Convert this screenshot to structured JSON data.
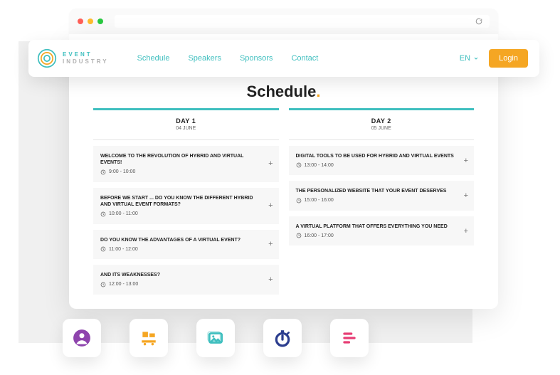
{
  "browser": {
    "title": ""
  },
  "brand": {
    "line1": "EVENT",
    "line2": "INDUSTRY"
  },
  "nav": {
    "items": [
      "Schedule",
      "Speakers",
      "Sponsors",
      "Contact"
    ],
    "lang": "EN",
    "login": "Login"
  },
  "page": {
    "title": "Schedule",
    "title_dot": "."
  },
  "days": [
    {
      "name": "DAY 1",
      "date": "04 JUNE",
      "sessions": [
        {
          "title": "WELCOME TO THE REVOLUTION OF HYBRID AND VIRTUAL EVENTS!",
          "time": "9:00 - 10:00"
        },
        {
          "title": "BEFORE WE START ... DO YOU KNOW THE DIFFERENT HYBRID AND VIRTUAL EVENT FORMATS?",
          "time": "10:00 - 11:00"
        },
        {
          "title": "DO YOU KNOW THE ADVANTAGES OF A VIRTUAL EVENT?",
          "time": "11:00 - 12:00"
        },
        {
          "title": "AND ITS WEAKNESSES?",
          "time": "12:00 - 13:00"
        }
      ]
    },
    {
      "name": "DAY 2",
      "date": "05 JUNE",
      "sessions": [
        {
          "title": "DIGITAL TOOLS TO BE USED FOR HYBRID AND VIRTUAL EVENTS",
          "time": "13:00 - 14:00"
        },
        {
          "title": "THE PERSONALIZED WEBSITE THAT YOUR EVENT DESERVES",
          "time": "15:00 - 16:00"
        },
        {
          "title": "A VIRTUAL PLATFORM THAT OFFERS EVERYTHING YOU NEED",
          "time": "16:00 - 17:00"
        }
      ]
    }
  ],
  "tools": {
    "items": [
      {
        "name": "profile-icon",
        "color": "#8e44ad"
      },
      {
        "name": "blocks-icon",
        "color": "#f5a623"
      },
      {
        "name": "image-icon",
        "color": "#3fbfbf"
      },
      {
        "name": "stopwatch-icon",
        "color": "#2c3e8f"
      },
      {
        "name": "align-icon",
        "color": "#e73d74"
      }
    ]
  },
  "expand_plus": "+"
}
